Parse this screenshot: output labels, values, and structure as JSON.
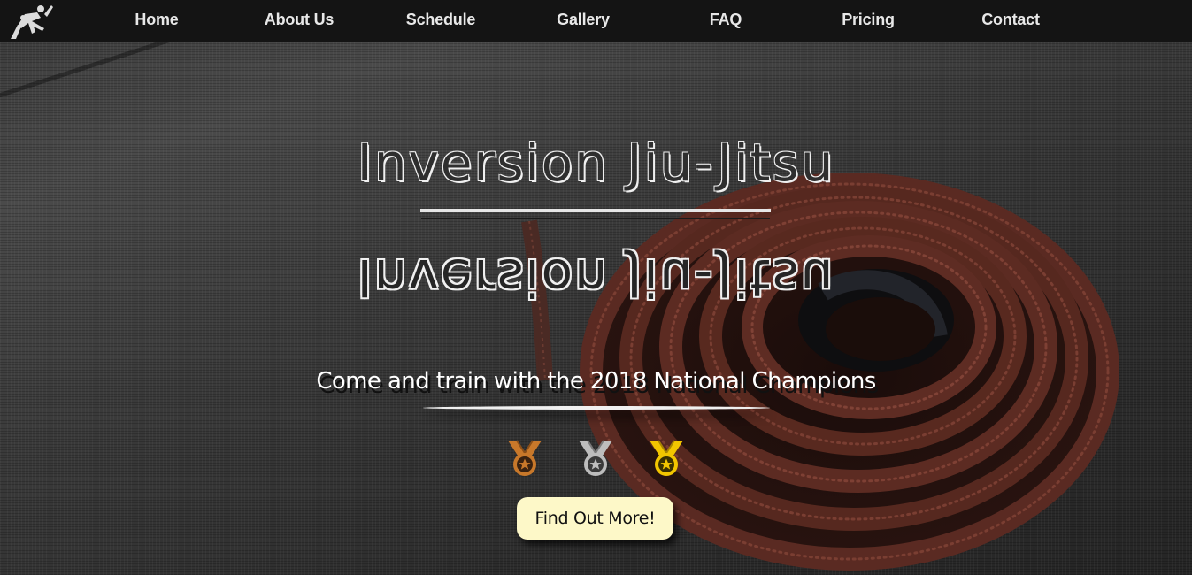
{
  "nav": {
    "items": [
      {
        "label": "Home"
      },
      {
        "label": "About Us"
      },
      {
        "label": "Schedule"
      },
      {
        "label": "Gallery"
      },
      {
        "label": "FAQ"
      },
      {
        "label": "Pricing"
      },
      {
        "label": "Contact"
      }
    ],
    "logo_icon": "jiu-jitsu-figures-logo"
  },
  "hero": {
    "title": "Inversion Jiu-Jitsu",
    "title_mirrored": "Inversion Jiu-Jitsu",
    "tagline": "Come and train with the 2018 National Champions",
    "medals": [
      {
        "icon": "bronze-medal-icon",
        "color": "#c8782a"
      },
      {
        "icon": "silver-medal-icon",
        "color": "#bdbdbd"
      },
      {
        "icon": "gold-medal-icon",
        "color": "#f2c500"
      }
    ],
    "cta_label": "Find Out More!"
  },
  "colors": {
    "nav_background": "#141414",
    "cta_background": "#fdf8c8",
    "belt_brown": "#5a2a22"
  }
}
